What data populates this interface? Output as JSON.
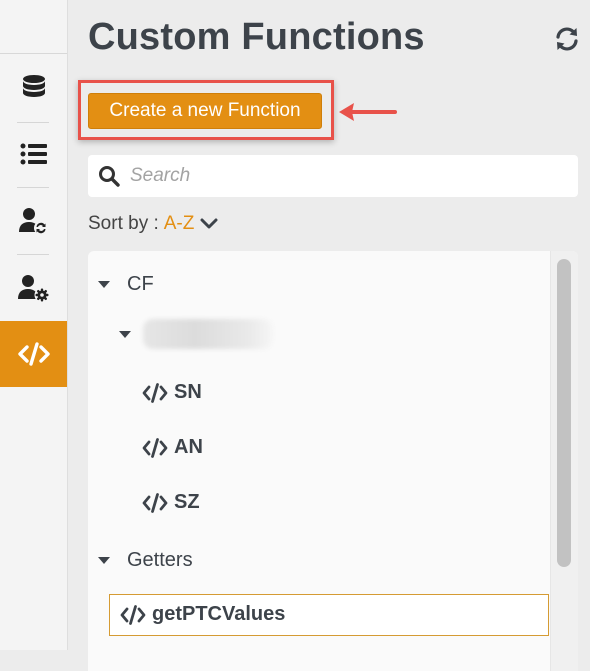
{
  "page": {
    "title": "Custom Functions"
  },
  "toolbar": {
    "create_label": "Create a new Function"
  },
  "search": {
    "placeholder": "Search"
  },
  "sort": {
    "label": "Sort by :",
    "value": "A-Z"
  },
  "rail": {
    "items": [
      {
        "icon": "database-icon",
        "active": false
      },
      {
        "icon": "list-icon",
        "active": false
      },
      {
        "icon": "user-sync-icon",
        "active": false
      },
      {
        "icon": "user-settings-icon",
        "active": false
      },
      {
        "icon": "code-icon",
        "active": true
      }
    ]
  },
  "colors": {
    "accent": "#e38f13",
    "highlight": "#e8524a",
    "title": "#3d434a"
  },
  "tree": {
    "groups": [
      {
        "label": "CF",
        "children": [
          {
            "label": "",
            "blurred": true,
            "leaves": [
              "SN",
              "AN",
              "SZ"
            ]
          }
        ]
      },
      {
        "label": "Getters",
        "leaves": [
          "getPTCValues"
        ]
      }
    ]
  }
}
